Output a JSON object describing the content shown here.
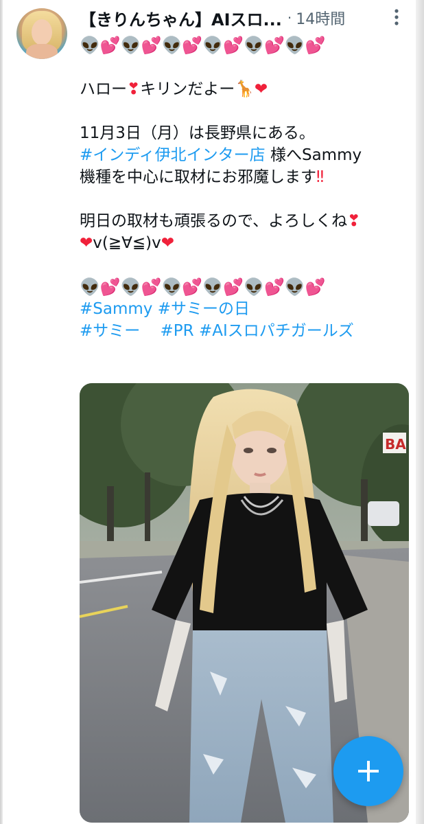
{
  "post": {
    "author_name": "【きりんちゃん】AIスロ...",
    "separator": "·",
    "timestamp": "14時間",
    "more_icon": "more-vertical-icon",
    "lines": {
      "emoji_row": "👽💕👽💕👽💕👽💕👽💕👽💕",
      "greeting_a": "ハロー",
      "greeting_b": "キリンだよー",
      "date_line": "11月3日（月）は長野県にある。",
      "store_hashtag": "#インディ伊北インター店",
      "store_suffix": " 様へSammy",
      "visit_text": "機種を中心に取材にお邪魔します",
      "wish_text": "明日の取材も頑張るので、よろしくね",
      "kaomoji": "v(≧∀≦)v",
      "hashtags_1": [
        "#Sammy",
        "#サミーの日"
      ],
      "hashtags_2": [
        "#サミー",
        "#PR",
        "#AIスロパチガールズ"
      ]
    }
  },
  "media": {
    "alt": "",
    "sign_text": "BA"
  },
  "fab": {
    "icon": "plus-icon"
  },
  "colors": {
    "link": "#1d9bf0",
    "text": "#0f1419",
    "meta": "#536471",
    "fab": "#1d9bf0"
  }
}
